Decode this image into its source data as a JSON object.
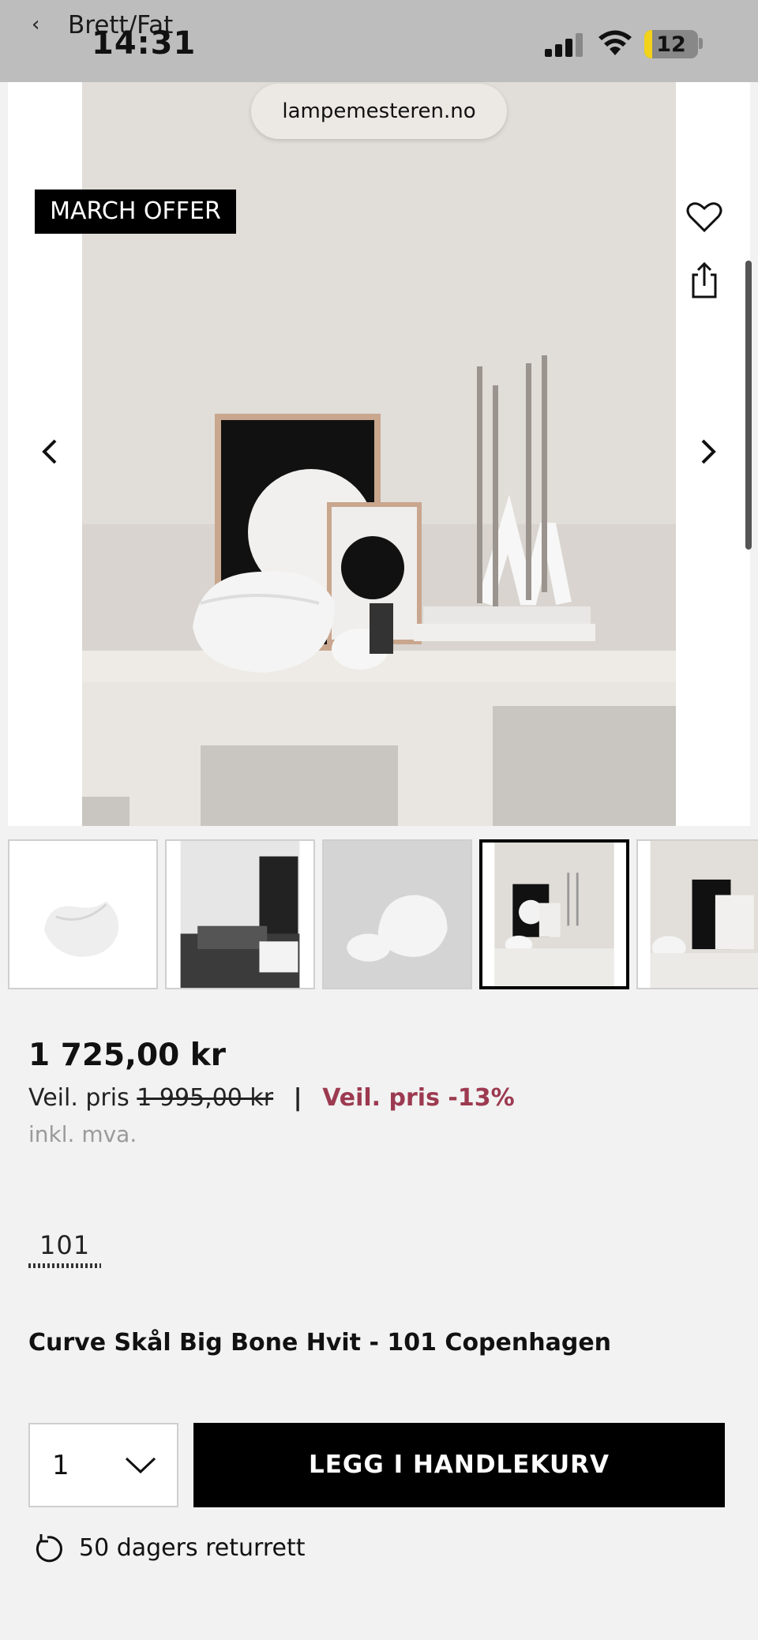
{
  "browser": {
    "back_label": "Brett/Fat",
    "time": "14:31",
    "battery_level": "12",
    "url": "lampemesteren.no"
  },
  "gallery": {
    "badge": "MARCH OFFER",
    "icons": [
      "heart-icon",
      "share-icon",
      "chevron-left-icon",
      "chevron-right-icon"
    ],
    "active_thumbnail_index": 3,
    "thumbnail_count": 5
  },
  "product": {
    "price": "1 725,00 kr",
    "veil_label": "Veil. pris",
    "old_price": "1 995,00 kr",
    "separator": "|",
    "discount": "Veil. pris -13%",
    "vat_note": "inkl. mva.",
    "brand_logo_text": "101",
    "title": "Curve Skål Big Bone Hvit - 101 Copenhagen"
  },
  "purchase": {
    "quantity": "1",
    "add_to_cart": "LEGG I HANDLEKURV",
    "returns": "50 dagers returrett"
  },
  "colors": {
    "discount": "#9c3a50",
    "button_bg": "#000000",
    "background": "#f2f2f2"
  }
}
